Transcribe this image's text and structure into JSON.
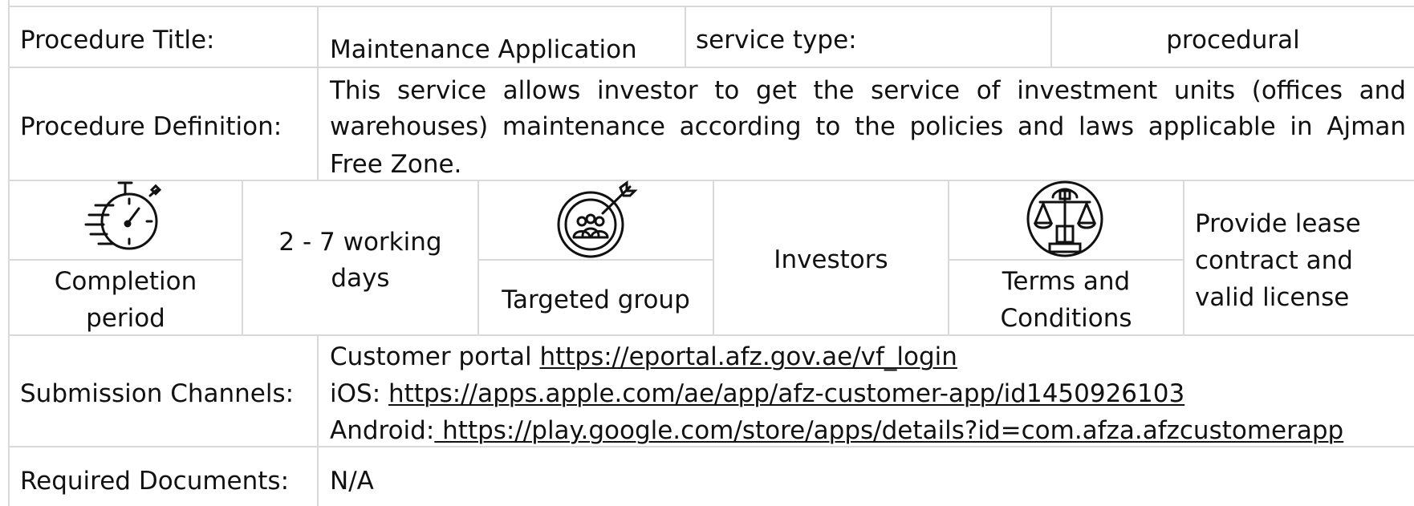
{
  "row_title": {
    "label": "Procedure Title:",
    "value": "Maintenance Application",
    "type_label": "service type:",
    "type_value": "procedural"
  },
  "row_definition": {
    "label": "Procedure Definition:",
    "line1": "This service allows investor to get the service of investment units (offices and",
    "line2": "warehouses) maintenance according to the policies and laws applicable in Ajman",
    "line3": "Free Zone."
  },
  "row_info": {
    "completion_line1": "Completion",
    "completion_line2": "period",
    "duration_line1": "2 - 7 working",
    "duration_line2": "days",
    "targeted_label": "Targeted group",
    "targeted_value": "Investors",
    "terms_line1": "Terms and",
    "terms_line2": "Conditions",
    "terms_value_line1": "Provide lease",
    "terms_value_line2": "contract and",
    "terms_value_line3": "valid license"
  },
  "row_channels": {
    "label": "Submission Channels:",
    "portal_prefix": "Customer portal ",
    "portal_link": "https://eportal.afz.gov.ae/vf_login",
    "ios_prefix": "iOS: ",
    "ios_link": "https://apps.apple.com/ae/app/afz-customer-app/id1450926103",
    "android_prefix": "Android:",
    "android_link": " https://play.google.com/store/apps/details?id=com.afza.afzcustomerapp"
  },
  "row_documents": {
    "label": "Required Documents:",
    "value": "N/A"
  },
  "icons": {
    "completion": "stopwatch-icon",
    "targeted": "target-group-icon",
    "terms": "scales-icon"
  },
  "colors": {
    "border": "#d9d9d9",
    "text": "#111111",
    "background": "#ffffff"
  }
}
